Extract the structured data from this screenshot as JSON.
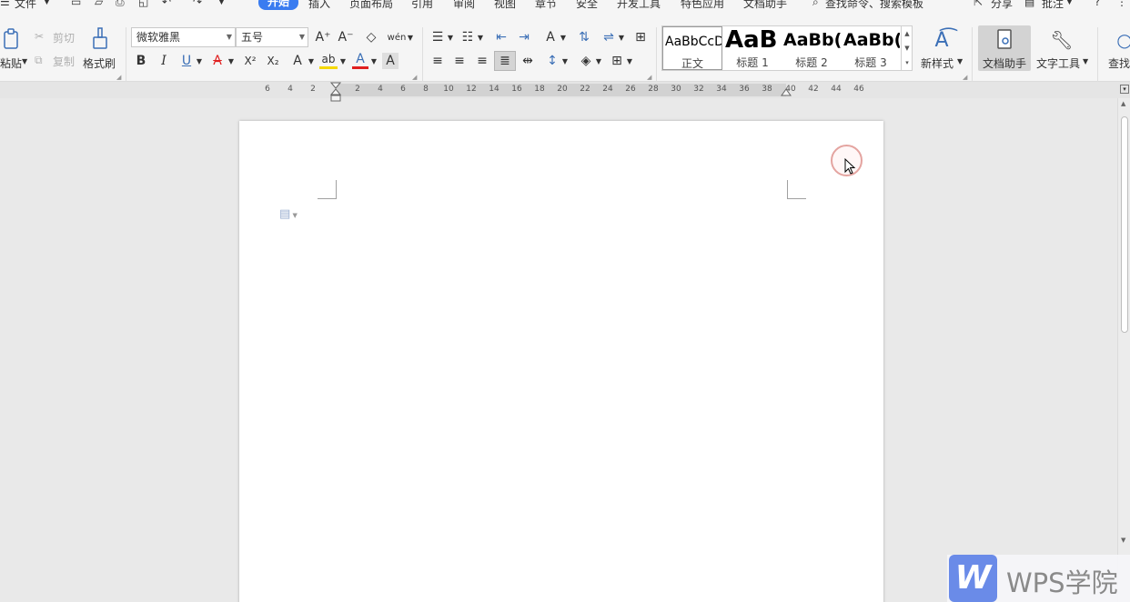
{
  "menu": {
    "file": "文件",
    "tabs": [
      "开始",
      "插入",
      "页面布局",
      "引用",
      "审阅",
      "视图",
      "章节",
      "安全",
      "开发工具",
      "特色应用",
      "文档助手"
    ],
    "search": "查找命令、搜索模板",
    "share": "分享",
    "comment": "批注",
    "help": "?"
  },
  "clipboard": {
    "paste": "粘贴",
    "cut": "剪切",
    "copy": "复制",
    "format_painter": "格式刷"
  },
  "font": {
    "family": "微软雅黑",
    "size": "五号",
    "bold": "B",
    "italic": "I",
    "underline": "U",
    "strike": "A",
    "superscript": "X²",
    "subscript": "X₂",
    "text_effect": "A",
    "highlight": "ab",
    "color": "A",
    "shading": "A",
    "grow": "A⁺",
    "shrink": "A⁻",
    "phonetic": "wén"
  },
  "styles": {
    "items": [
      {
        "preview": "AaBbCcD",
        "caption": "正文"
      },
      {
        "preview": "AaB",
        "caption": "标题 1"
      },
      {
        "preview": "AaBb(",
        "caption": "标题 2"
      },
      {
        "preview": "AaBb(",
        "caption": "标题 3"
      }
    ],
    "new_style": "新样式"
  },
  "tools": {
    "doc_helper": "文档助手",
    "text_tools": "文字工具",
    "find": "查找"
  },
  "ruler": {
    "ticks": [
      "6",
      "4",
      "2",
      "2",
      "4",
      "6",
      "8",
      "10",
      "12",
      "14",
      "16",
      "18",
      "20",
      "22",
      "24",
      "26",
      "28",
      "30",
      "32",
      "34",
      "36",
      "38",
      "40",
      "42",
      "44",
      "46"
    ]
  },
  "watermark": {
    "logo": "W",
    "text": "WPS学院"
  },
  "colors": {
    "accent": "#3a7cf0",
    "font_color_bar": "#e02020",
    "highlight_bar": "#f5d800",
    "logo_blue": "#6a8be8"
  }
}
